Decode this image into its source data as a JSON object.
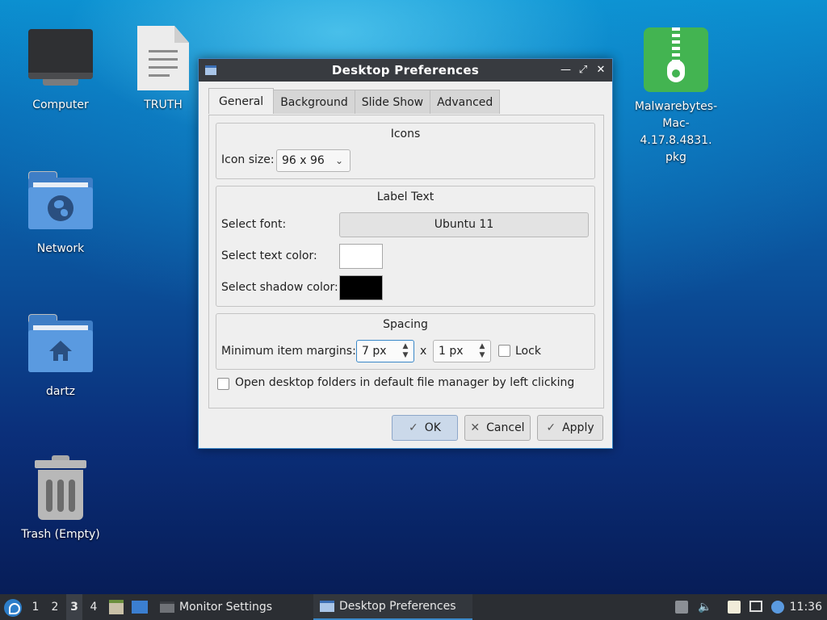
{
  "desktop": {
    "icons": [
      {
        "label": "Computer",
        "icon": "computer-icon"
      },
      {
        "label": "TRUTH",
        "icon": "text-file-icon"
      },
      {
        "label": "Network",
        "icon": "network-folder-icon"
      },
      {
        "label": "dartz",
        "icon": "home-folder-icon"
      },
      {
        "label": "Trash (Empty)",
        "icon": "trash-icon"
      },
      {
        "label": "Malwarebytes-\nMac-4.17.8.4831.\npkg",
        "icon": "package-archive-icon"
      }
    ]
  },
  "dialog": {
    "title": "Desktop Preferences",
    "title_buttons": [
      "minimize",
      "maximize",
      "close"
    ],
    "tabs": [
      {
        "label": "General",
        "active": true
      },
      {
        "label": "Background",
        "active": false
      },
      {
        "label": "Slide Show",
        "active": false
      },
      {
        "label": "Advanced",
        "active": false
      }
    ],
    "icons_group": {
      "title": "Icons",
      "icon_size_label": "Icon size:",
      "icon_size_value": "96 x 96"
    },
    "label_group": {
      "title": "Label Text",
      "font_label": "Select font:",
      "font_value": "Ubuntu 11",
      "text_color_label": "Select text color:",
      "text_color": "#ffffff",
      "shadow_color_label": "Select shadow color:",
      "shadow_color": "#000000"
    },
    "spacing_group": {
      "title": "Spacing",
      "margins_label": "Minimum item margins:",
      "margin_x": "7 px",
      "separator": "x",
      "margin_y": "1 px",
      "lock_label": "Lock",
      "lock_checked": false
    },
    "open_folders_label": "Open desktop folders in default file manager by left clicking",
    "open_folders_checked": false,
    "buttons": {
      "ok": "OK",
      "cancel": "Cancel",
      "apply": "Apply"
    }
  },
  "taskbar": {
    "workspaces": [
      "1",
      "2",
      "3",
      "4"
    ],
    "active_workspace": "3",
    "tasks": [
      {
        "label": "Monitor Settings",
        "active": false
      },
      {
        "label": "Desktop Preferences",
        "active": true
      }
    ],
    "clock": "11:36"
  },
  "colors": {
    "accent": "#3a88c8",
    "titlebar": "#383b40",
    "taskbar": "#2b2e33"
  }
}
